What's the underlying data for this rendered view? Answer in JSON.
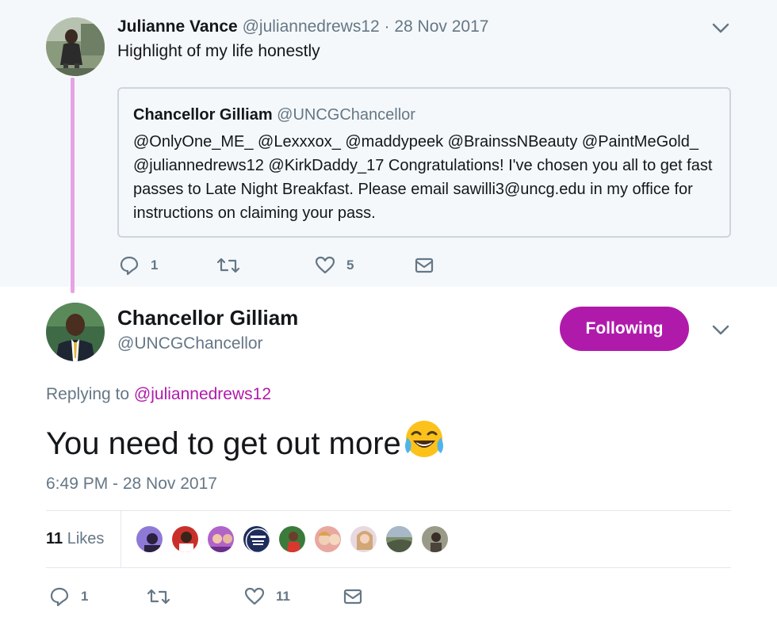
{
  "parent_tweet": {
    "display_name": "Julianne Vance",
    "handle": "@juliannedrews12",
    "date": "· 28 Nov 2017",
    "text": "Highlight of my life honestly",
    "quoted": {
      "display_name": "Chancellor Gilliam",
      "handle": "@UNCGChancellor",
      "text": "@OnlyOne_ME_ @Lexxxox_ @maddypeek @BrainssNBeauty @PaintMeGold_ @juliannedrews12 @KirkDaddy_17 Congratulations! I've chosen you all to get fast passes to Late Night Breakfast. Please email sawilli3@uncg.edu in my office for instructions on claiming your pass."
    },
    "actions": {
      "replies": "1",
      "retweets": "",
      "likes": "5"
    }
  },
  "main_tweet": {
    "display_name": "Chancellor Gilliam",
    "handle": "@UNCGChancellor",
    "follow_label": "Following",
    "replying_prefix": "Replying to",
    "replying_handle": "@juliannedrews12",
    "text": "You need to get out more",
    "emoji": "face-with-tears-of-joy",
    "timestamp": "6:49 PM - 28 Nov 2017",
    "likes_count": "11",
    "likes_label": "Likes",
    "liker_avatars": [
      "liker-1",
      "liker-2",
      "liker-3",
      "liker-uncg-financial-aid",
      "liker-5",
      "liker-6",
      "liker-7",
      "liker-8",
      "liker-9"
    ],
    "actions": {
      "replies": "1",
      "retweets": "",
      "likes": "11"
    }
  },
  "colors": {
    "accent": "#b01aab",
    "thread_line": "#e6a3e6",
    "muted_text": "#657786",
    "parent_background": "#f5f8fa",
    "border": "#ccd6dd"
  }
}
